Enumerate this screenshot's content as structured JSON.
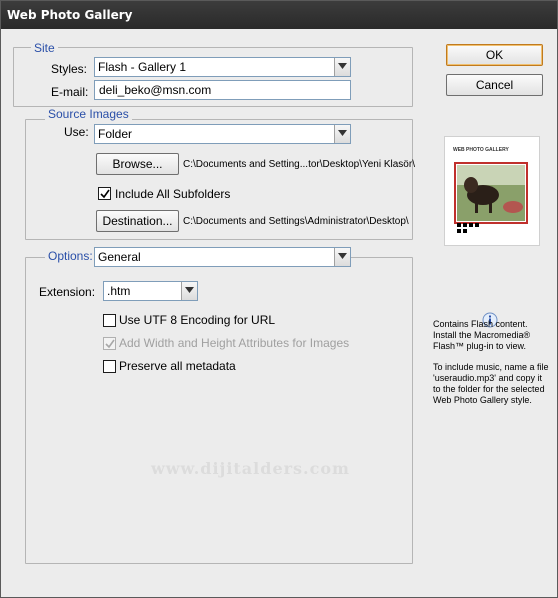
{
  "window": {
    "title": "Web Photo Gallery"
  },
  "site": {
    "legend": "Site",
    "styles_label": "Styles:",
    "styles_value": "Flash - Gallery 1",
    "email_label": "E-mail:",
    "email_value": "deli_beko@msn.com"
  },
  "source": {
    "legend": "Source Images",
    "use_label": "Use:",
    "use_value": "Folder",
    "browse_label": "Browse...",
    "browse_path": "C:\\Documents and Setting...tor\\Desktop\\Yeni Klasör\\",
    "include_subfolders_label": "Include All Subfolders",
    "include_subfolders_checked": true,
    "destination_label": "Destination...",
    "destination_path": "C:\\Documents and Settings\\Administrator\\Desktop\\"
  },
  "options": {
    "legend": "Options:",
    "section_value": "General",
    "extension_label": "Extension:",
    "extension_value": ".htm",
    "utf8_label": "Use UTF 8 Encoding for URL",
    "utf8_checked": false,
    "width_height_label": "Add Width and Height Attributes for Images",
    "width_height_checked": true,
    "width_height_disabled": true,
    "metadata_label": "Preserve all metadata",
    "metadata_checked": false
  },
  "actions": {
    "ok_label": "OK",
    "cancel_label": "Cancel"
  },
  "preview": {
    "header_text": "WEB PHOTO GALLERY",
    "note_1": "Contains Flash content. Install the Macromedia® Flash™ plug-in to view.",
    "note_2": "To include music, name a file 'useraudio.mp3' and copy it to the folder for the selected Web Photo Gallery style."
  },
  "watermark": "www.dijitalders.com",
  "icons": {
    "dropdown": "chevron-down-icon",
    "checkmark": "check-icon",
    "info": "info-icon"
  },
  "colors": {
    "legend": "#2a4fa8",
    "default_button_border": "#c07a1e",
    "titlebar": "#2f2f2f"
  }
}
